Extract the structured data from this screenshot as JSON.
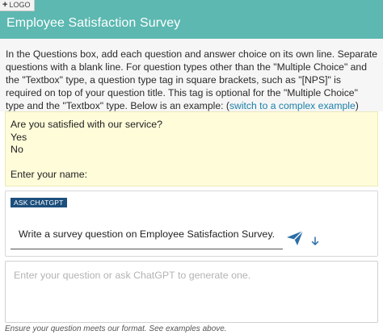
{
  "header": {
    "logo_label": "LOGO",
    "title": "Employee Satisfaction Survey",
    "background_color": "#5cb8b1"
  },
  "instructions": {
    "text": "In the Questions box, add each question and answer choice on its own line. Separate questions with a blank line. For question types other than the \"Multiple Choice\" and the \"Textbox\" type, a question type tag in square brackets, such as \"[NPS]\" is required on top of your question title. This tag is optional for the \"Multiple Choice\" type and the \"Textbox\" type. Below is an example: (",
    "link_label": "switch to a complex example",
    "closing": ")"
  },
  "example": {
    "lines": [
      "Are you satisfied with our service?",
      "Yes",
      "No",
      "",
      "Enter your name:"
    ]
  },
  "chatgpt": {
    "badge_label": "ASK CHATGPT",
    "prompt_value": "Write a survey question on Employee Satisfaction Survey.",
    "send_icon": "send-icon",
    "insert_icon": "arrow-down-icon",
    "accent_color": "#2b6ea6"
  },
  "questions": {
    "placeholder": "Enter your question or ask ChatGPT to generate one."
  },
  "footnote": "Ensure your question meets our format. See examples above."
}
